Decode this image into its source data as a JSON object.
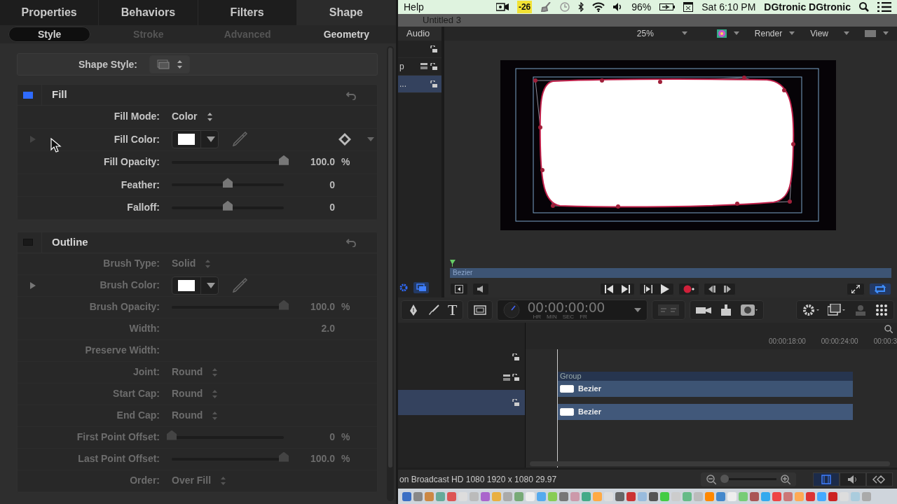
{
  "inspector": {
    "tabs": [
      {
        "label": "Properties",
        "selected": false
      },
      {
        "label": "Behaviors",
        "selected": false
      },
      {
        "label": "Filters",
        "selected": false
      },
      {
        "label": "Shape",
        "selected": true
      }
    ],
    "subtabs": [
      {
        "label": "Style",
        "selected": true,
        "disabled": false
      },
      {
        "label": "Stroke",
        "selected": false,
        "disabled": true
      },
      {
        "label": "Advanced",
        "selected": false,
        "disabled": true
      },
      {
        "label": "Geometry",
        "selected": false,
        "disabled": false
      }
    ],
    "shape_style": {
      "label": "Shape Style:"
    },
    "sections": [
      {
        "title": "Fill",
        "enabled": true,
        "rows": [
          {
            "kind": "popup",
            "label": "Fill Mode:",
            "value": "Color"
          },
          {
            "kind": "color",
            "label": "Fill Color:",
            "keyframe": true
          },
          {
            "kind": "slider",
            "label": "Fill Opacity:",
            "level": 1,
            "value": "100.0",
            "unit": "%"
          },
          {
            "kind": "slider",
            "label": "Feather:",
            "level": 0.5,
            "value": "0"
          },
          {
            "kind": "slider",
            "label": "Falloff:",
            "level": 0.5,
            "value": "0"
          }
        ]
      },
      {
        "title": "Outline",
        "enabled": false,
        "rows": [
          {
            "kind": "popup",
            "label": "Brush Type:",
            "value": "Solid"
          },
          {
            "kind": "color",
            "label": "Brush Color:",
            "keyframe": false
          },
          {
            "kind": "slider",
            "label": "Brush Opacity:",
            "level": 1,
            "value": "100.0",
            "unit": "%"
          },
          {
            "kind": "number",
            "label": "Width:",
            "value": "2.0"
          },
          {
            "kind": "label",
            "label": "Preserve Width:"
          },
          {
            "kind": "popup",
            "label": "Joint:",
            "value": "Round"
          },
          {
            "kind": "popup",
            "label": "Start Cap:",
            "value": "Round"
          },
          {
            "kind": "popup",
            "label": "End Cap:",
            "value": "Round"
          },
          {
            "kind": "slider",
            "label": "First Point Offset:",
            "level": 0,
            "value": "0",
            "unit": "%"
          },
          {
            "kind": "slider",
            "label": "Last Point Offset:",
            "level": 1,
            "value": "100.0",
            "unit": "%"
          },
          {
            "kind": "popup",
            "label": "Order:",
            "value": "Over Fill"
          }
        ]
      }
    ]
  },
  "menubar": {
    "menu": "Help",
    "badge": "-26",
    "battery": "96%",
    "clock": "Sat 6:10 PM",
    "user": "DGtronic DGtronic"
  },
  "window": {
    "title": "Untitled 3"
  },
  "layers": {
    "header": "Audio",
    "rows": [
      {
        "selected": false
      },
      {
        "text": "p",
        "selected": false
      },
      {
        "text": "...",
        "selected": true
      }
    ]
  },
  "viewer": {
    "zoom": "25%",
    "render": "Render",
    "view": "View"
  },
  "mini_timeline": {
    "clip": "Bezier"
  },
  "toolbar": {
    "text_tool": "T",
    "timecode": "00:00:00:00",
    "units": [
      "HR",
      "MIN",
      "SEC",
      "FR"
    ]
  },
  "timeline": {
    "ruler": [
      "00:00:18:00",
      "00:00:24:00",
      "00:00:3"
    ],
    "tracks": [
      {
        "kind": "group",
        "name": "Group",
        "selected": false
      },
      {
        "kind": "clip",
        "name": "Bezier",
        "selected": false
      },
      {
        "kind": "clip",
        "name": "Bezier",
        "selected": true
      }
    ]
  },
  "status_bar": {
    "text": "on Broadcast HD 1080 1920 x 1080 29.97"
  }
}
